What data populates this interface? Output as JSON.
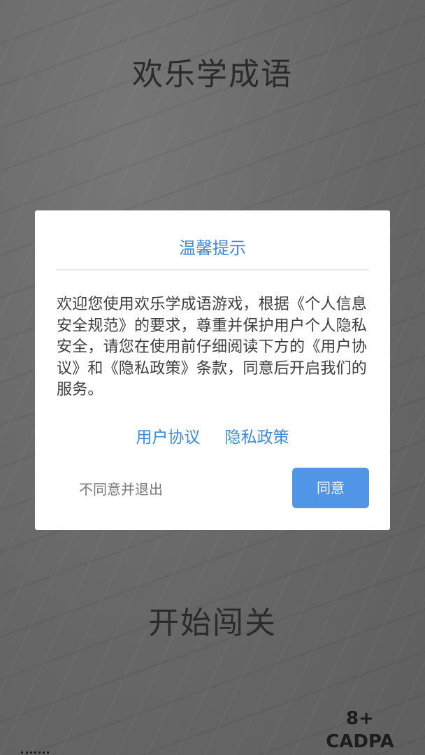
{
  "app": {
    "title": "欢乐学成语",
    "start_button": "开始闯关",
    "age_rating": "8+",
    "rating_org": "CADPA"
  },
  "dialog": {
    "title": "温馨提示",
    "body": "欢迎您使用欢乐学成语游戏，根据《个人信息安全规范》的要求，尊重并保护用户个人隐私安全，请您在使用前仔细阅读下方的《用户协议》和《隐私政策》条款，同意后开启我们的服务。",
    "user_agreement_link": "用户协议",
    "privacy_policy_link": "隐私政策",
    "decline_button": "不同意并退出",
    "agree_button": "同意"
  },
  "colors": {
    "accent": "#3f8ad9",
    "button_bg": "#5095e6",
    "background": "#6a6a6a"
  }
}
